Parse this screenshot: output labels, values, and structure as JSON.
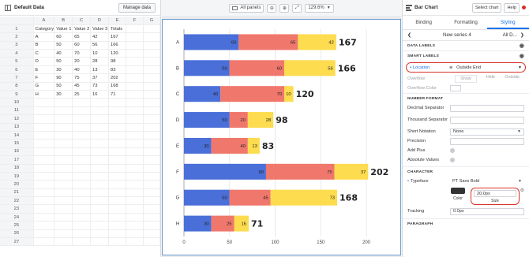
{
  "left_panel": {
    "title": "Default Data",
    "manage_label": "Manage data",
    "column_letters": [
      "A",
      "B",
      "C",
      "D",
      "E",
      "F",
      "G"
    ],
    "row_numbers": [
      "1",
      "2",
      "3",
      "4",
      "5",
      "6",
      "7",
      "8",
      "9",
      "10",
      "11",
      "12",
      "13",
      "14",
      "15",
      "16",
      "17",
      "18",
      "19",
      "20",
      "21",
      "22",
      "23",
      "24",
      "25",
      "26",
      "27"
    ],
    "header_row": [
      "Category",
      "Value 1",
      "Value 2",
      "Value 3",
      "Totals",
      "",
      ""
    ],
    "rows": [
      [
        "A",
        "60",
        "65",
        "42",
        "167",
        "",
        ""
      ],
      [
        "B",
        "50",
        "60",
        "56",
        "166",
        "",
        ""
      ],
      [
        "C",
        "40",
        "70",
        "10",
        "120",
        "",
        ""
      ],
      [
        "D",
        "50",
        "20",
        "28",
        "98",
        "",
        ""
      ],
      [
        "E",
        "30",
        "40",
        "13",
        "83",
        "",
        ""
      ],
      [
        "F",
        "90",
        "75",
        "37",
        "202",
        "",
        ""
      ],
      [
        "G",
        "50",
        "45",
        "73",
        "168",
        "",
        ""
      ],
      [
        "H",
        "30",
        "25",
        "16",
        "71",
        "",
        ""
      ]
    ]
  },
  "toolbar": {
    "panels_label": "All panels",
    "zoom_level": "129.6%"
  },
  "right_panel": {
    "title": "Bar Chart",
    "select_chart_label": "Select chart",
    "help_label": "Help",
    "tabs": [
      "Binding",
      "Formatting",
      "Styling"
    ],
    "series_name": "New series 4",
    "series_scope": "All D...",
    "data_labels_heading": "DATA LABELS",
    "smart_labels_heading": "SMART LABELS",
    "location_label": "Location",
    "location_value": "Outside End",
    "overflow_label": "Overflow",
    "overflow_options": [
      "Show",
      "Hide",
      "Outside"
    ],
    "overflow_color_label": "Overflow Color",
    "number_format_heading": "NUMBER FORMAT",
    "decimal_separator_label": "Decimal Separator",
    "thousand_separator_label": "Thousand Separator",
    "short_notation_label": "Short Notation",
    "short_notation_value": "None",
    "precision_label": "Precision",
    "add_plus_label": "Add Plus",
    "absolute_values_label": "Absolute Values",
    "character_heading": "CHARACTER",
    "typeface_label": "Typeface",
    "typeface_value": "PT Sans Bold",
    "color_caption": "Color",
    "size_value": "20.0px",
    "size_caption": "Size",
    "tracking_label": "Tracking",
    "tracking_value": "0.0px",
    "paragraph_heading": "PARAGRAPH"
  },
  "colors": {
    "value1": "#4a6fd9",
    "value2": "#f0776c",
    "value3": "#fddc4f",
    "accent": "#1a73e8",
    "highlight": "#d93025"
  },
  "chart_data": {
    "type": "bar",
    "orientation": "horizontal",
    "stacked": true,
    "categories": [
      "A",
      "B",
      "C",
      "D",
      "E",
      "F",
      "G",
      "H"
    ],
    "series": [
      {
        "values": [
          60,
          50,
          40,
          50,
          30,
          90,
          50,
          30
        ]
      },
      {
        "values": [
          65,
          60,
          70,
          20,
          40,
          75,
          45,
          25
        ]
      },
      {
        "values": [
          42,
          56,
          10,
          28,
          13,
          37,
          73,
          16
        ]
      }
    ],
    "totals": [
      167,
      166,
      120,
      98,
      83,
      202,
      168,
      71
    ],
    "x_ticks": [
      0,
      50,
      100,
      150,
      200
    ],
    "xlim": [
      0,
      200
    ],
    "grid": true
  }
}
